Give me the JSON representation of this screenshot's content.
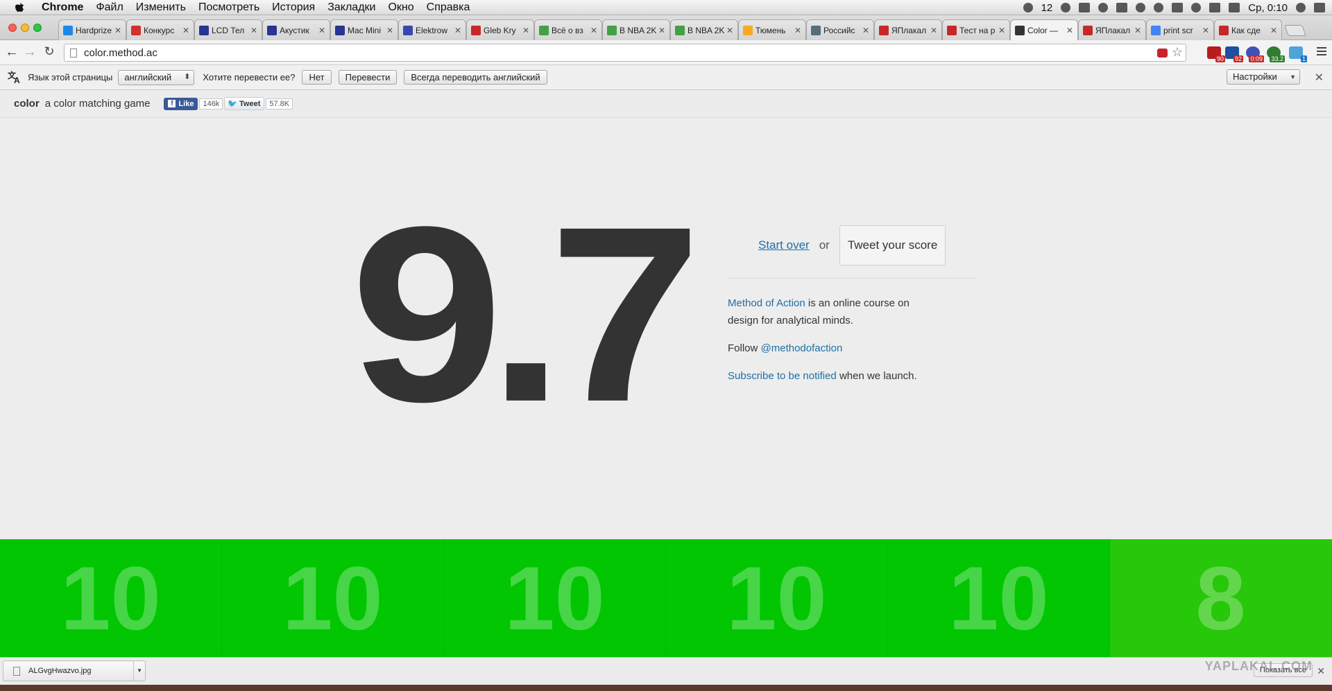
{
  "menubar": {
    "app": "Chrome",
    "items": [
      "Файл",
      "Изменить",
      "Посмотреть",
      "История",
      "Закладки",
      "Окно",
      "Справка"
    ],
    "notification_count": "12",
    "clock": "Ср, 0:10"
  },
  "tabs": [
    {
      "title": "Hardprize",
      "color": "#1e88e5"
    },
    {
      "title": "Конкурс",
      "color": "#d32f2f"
    },
    {
      "title": "LCD Тел",
      "color": "#283593"
    },
    {
      "title": "Акустик",
      "color": "#283593"
    },
    {
      "title": "Mac Mini",
      "color": "#283593"
    },
    {
      "title": "Elektrow",
      "color": "#3949ab"
    },
    {
      "title": "Gleb Kry",
      "color": "#c62828"
    },
    {
      "title": "Всё о вз",
      "color": "#43a047"
    },
    {
      "title": "B NBA 2K",
      "color": "#43a047"
    },
    {
      "title": "B NBA 2K",
      "color": "#43a047"
    },
    {
      "title": "Тюмень",
      "color": "#f9a825"
    },
    {
      "title": "Российс",
      "color": "#546e7a"
    },
    {
      "title": "ЯПлакал",
      "color": "#c62828"
    },
    {
      "title": "Тест на р",
      "color": "#c62828"
    },
    {
      "title": "Color —",
      "color": "#333333",
      "active": true
    },
    {
      "title": "ЯПлакал",
      "color": "#c62828"
    },
    {
      "title": "print scr",
      "color": "#4285f4"
    },
    {
      "title": "Как сде",
      "color": "#c62828"
    }
  ],
  "toolbar": {
    "url": "color.method.ac",
    "ext_badges": [
      "90",
      "92",
      "0:09",
      "33.2",
      "1"
    ]
  },
  "translate": {
    "page_language_label": "Язык этой страницы",
    "language_value": "английский",
    "question": "Хотите перевести ее?",
    "no_label": "Нет",
    "translate_label": "Перевести",
    "always_label": "Всегда переводить английский",
    "settings_label": "Настройки"
  },
  "site": {
    "brand": "color",
    "tagline": "a color matching game",
    "fb_like_label": "Like",
    "fb_count": "146k",
    "tweet_label": "Tweet",
    "tweet_count": "57.8K"
  },
  "result": {
    "score": "9.7",
    "start_over": "Start over",
    "or": "or",
    "tweet_score": "Tweet your score",
    "course_link": "Method of Action",
    "course_text": " is an online course on design for analytical minds.",
    "follow_label": "Follow ",
    "twitter_handle": "@methodofaction",
    "subscribe_link": "Subscribe to be notified",
    "subscribe_text": " when we launch."
  },
  "round_scores": [
    "10",
    "10",
    "10",
    "10",
    "10",
    "8"
  ],
  "downloads": {
    "file_name": "ALGvgHwazvo.jpg",
    "show_all": "Показать все",
    "watermark": "YAPLAKAL.COM"
  },
  "colors": {
    "score_text": "#333333",
    "link": "#1f6ea6",
    "strip_green": "#01c601",
    "strip_last": "#27c70a"
  }
}
